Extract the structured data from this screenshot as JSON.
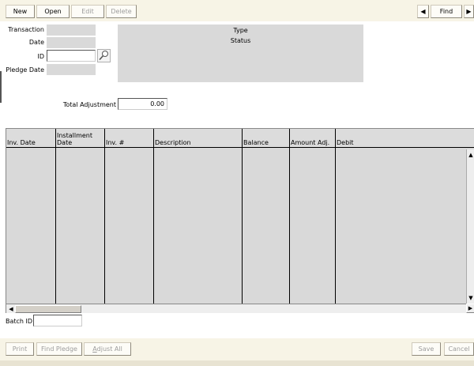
{
  "toolbar_top": {
    "new": "New",
    "open": "Open",
    "edit": "Edit",
    "delete": "Delete",
    "prev_icon": "left-arrow-icon",
    "find": "Find",
    "next_icon": "right-arrow-icon"
  },
  "form": {
    "transaction_label": "Transaction",
    "date_label": "Date",
    "id_label": "ID",
    "pledge_date_label": "Pledge Date",
    "lookup_icon": "magnifier-icon",
    "type_label": "Type",
    "status_label": "Status",
    "total_adjustment_label": "Total Adjustment",
    "total_adjustment_value": "0.00",
    "batch_id_label": "Batch ID"
  },
  "grid": {
    "columns": [
      "Inv. Date",
      "Installment\nDate",
      "Inv. #",
      "Description",
      "Balance",
      "Amount Adj.",
      "Debit"
    ]
  },
  "toolbar_bottom": {
    "print": "Print",
    "find_pledge": "Find Pledge",
    "adjust_all_underline": "A",
    "adjust_all_rest": "djust All",
    "save": "Save",
    "cancel": "Cancel"
  }
}
